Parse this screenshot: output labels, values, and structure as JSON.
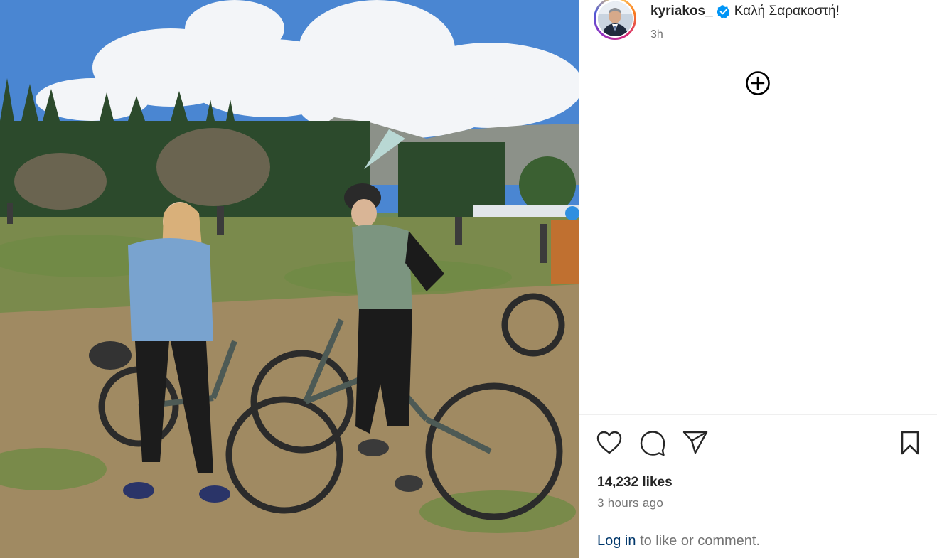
{
  "post": {
    "image_alt": "Two people standing with mountain bikes in a grassy field with trees, mountains and a cloudy blue sky",
    "username": "kyriakos_",
    "verified": true,
    "caption": "Καλή Σαρακοστή!",
    "posted_short": "3h",
    "likes": "14,232 likes",
    "posted_long": "3 hours ago"
  },
  "footer": {
    "login_link": "Log in",
    "login_rest": "to like or comment."
  },
  "icons": {
    "avatar": "avatar-icon",
    "verified": "verified-badge-icon",
    "add": "plus-circle-icon",
    "like": "heart-icon",
    "comment": "comment-bubble-icon",
    "share": "paper-plane-icon",
    "save": "bookmark-icon"
  },
  "colors": {
    "verified_blue": "#0095f6",
    "link_blue": "#00376b",
    "secondary_text": "#737373"
  }
}
